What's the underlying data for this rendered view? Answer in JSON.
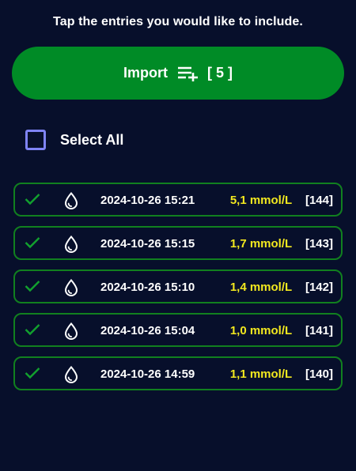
{
  "instruction": "Tap the entries you would like to include.",
  "import_button": {
    "label": "Import",
    "icon": "playlist-add-icon",
    "count": "[ 5 ]"
  },
  "select_all": {
    "label": "Select All",
    "checked": false
  },
  "colors": {
    "background": "#070f2b",
    "button": "#008b26",
    "accent": "#f2e81f",
    "checkbox": "#7f84f5",
    "row_border": "#11801f"
  },
  "entries": [
    {
      "datetime": "2024-10-26 15:21",
      "value": "5,1 mmol/L",
      "index": "[144]",
      "checked": true,
      "icon": "blood-drop-icon"
    },
    {
      "datetime": "2024-10-26 15:15",
      "value": "1,7 mmol/L",
      "index": "[143]",
      "checked": true,
      "icon": "blood-drop-icon"
    },
    {
      "datetime": "2024-10-26 15:10",
      "value": "1,4 mmol/L",
      "index": "[142]",
      "checked": true,
      "icon": "blood-drop-icon"
    },
    {
      "datetime": "2024-10-26 15:04",
      "value": "1,0 mmol/L",
      "index": "[141]",
      "checked": true,
      "icon": "blood-drop-icon"
    },
    {
      "datetime": "2024-10-26 14:59",
      "value": "1,1 mmol/L",
      "index": "[140]",
      "checked": true,
      "icon": "blood-drop-icon"
    }
  ]
}
